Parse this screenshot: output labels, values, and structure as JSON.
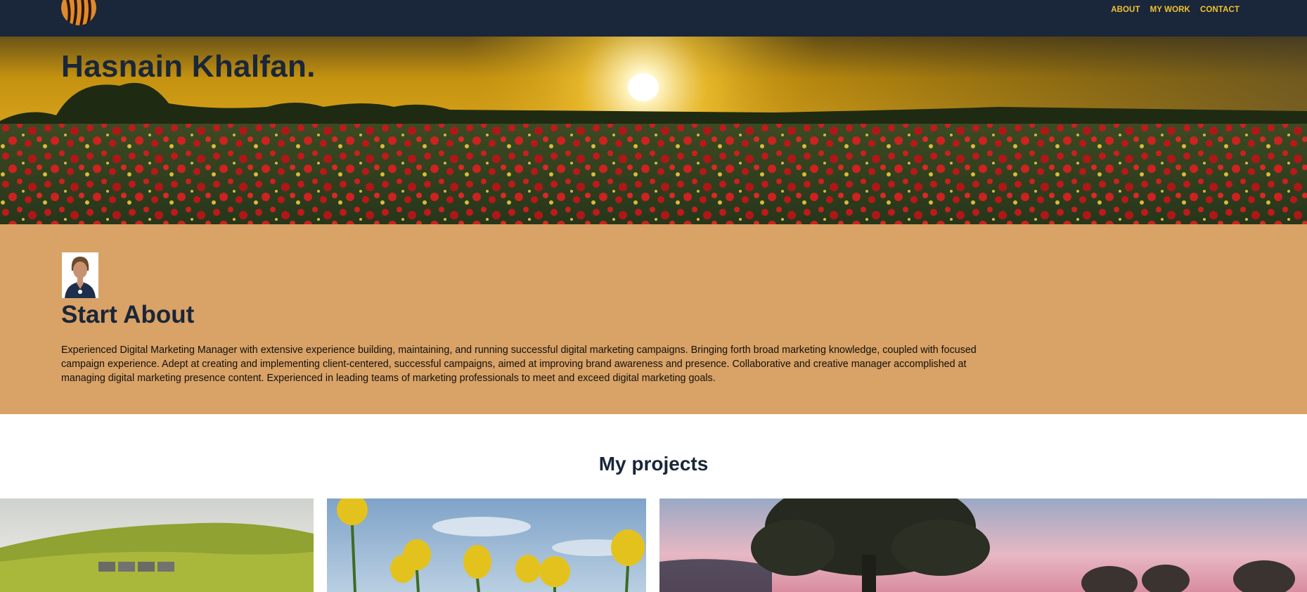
{
  "nav": {
    "logo_icon": "tiger-stripe-logo-icon",
    "links": [
      "ABOUT",
      "MY WORK",
      "CONTACT"
    ],
    "link_color": "#f1c232",
    "background": "#1a2639"
  },
  "hero": {
    "title": "Hasnain Khalfan.",
    "image": "sunset-poppy-field-image"
  },
  "about": {
    "avatar_icon": "person-avatar-icon",
    "title": "Start About",
    "text": "Experienced Digital Marketing Manager with extensive experience building, maintaining, and running successful digital marketing campaigns. Bringing forth broad marketing knowledge, coupled with focused campaign experience. Adept at creating and implementing client-centered, successful campaigns, aimed at improving brand awareness and presence. Collaborative and creative manager accomplished at managing digital marketing presence content. Experienced in leading teams of marketing professionals to meet and exceed digital marketing goals.",
    "background": "#d9a266"
  },
  "projects": {
    "title": "My projects",
    "cards": [
      {
        "image": "green-hills-barns-image"
      },
      {
        "image": "yellow-tulips-sky-image"
      },
      {
        "image": "tree-pink-sunset-image"
      }
    ]
  }
}
